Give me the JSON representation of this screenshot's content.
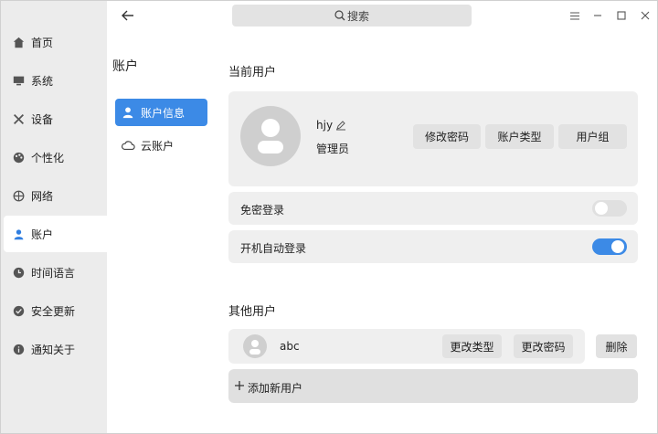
{
  "nav": {
    "items": [
      {
        "label": "首页",
        "icon": "home-icon"
      },
      {
        "label": "系统",
        "icon": "monitor-icon"
      },
      {
        "label": "设备",
        "icon": "tools-icon"
      },
      {
        "label": "个性化",
        "icon": "palette-icon"
      },
      {
        "label": "网络",
        "icon": "globe-icon"
      },
      {
        "label": "账户",
        "icon": "user-icon"
      },
      {
        "label": "时间语言",
        "icon": "clock-icon"
      },
      {
        "label": "安全更新",
        "icon": "shield-icon"
      },
      {
        "label": "通知关于",
        "icon": "info-icon"
      }
    ],
    "active": "账户"
  },
  "sub": {
    "title": "账户",
    "items": [
      {
        "label": "账户信息",
        "icon": "user-icon"
      },
      {
        "label": "云账户",
        "icon": "cloud-icon"
      }
    ]
  },
  "search": {
    "placeholder": "搜索"
  },
  "current_user": {
    "section_title": "当前用户",
    "name": "hjy",
    "role": "管理员",
    "buttons": {
      "change_password": "修改密码",
      "account_type": "账户类型",
      "user_group": "用户组"
    }
  },
  "settings": {
    "passwordless_login": {
      "label": "免密登录",
      "enabled": false
    },
    "auto_login": {
      "label": "开机自动登录",
      "enabled": true
    }
  },
  "other_users": {
    "section_title": "其他用户",
    "users": [
      {
        "name": "abc",
        "change_type": "更改类型",
        "change_password": "更改密码",
        "delete": "删除"
      }
    ],
    "add_label": "添加新用户"
  },
  "colors": {
    "accent": "#3c8ae6",
    "nav_bg": "#ececec",
    "card_bg": "#efefef"
  }
}
